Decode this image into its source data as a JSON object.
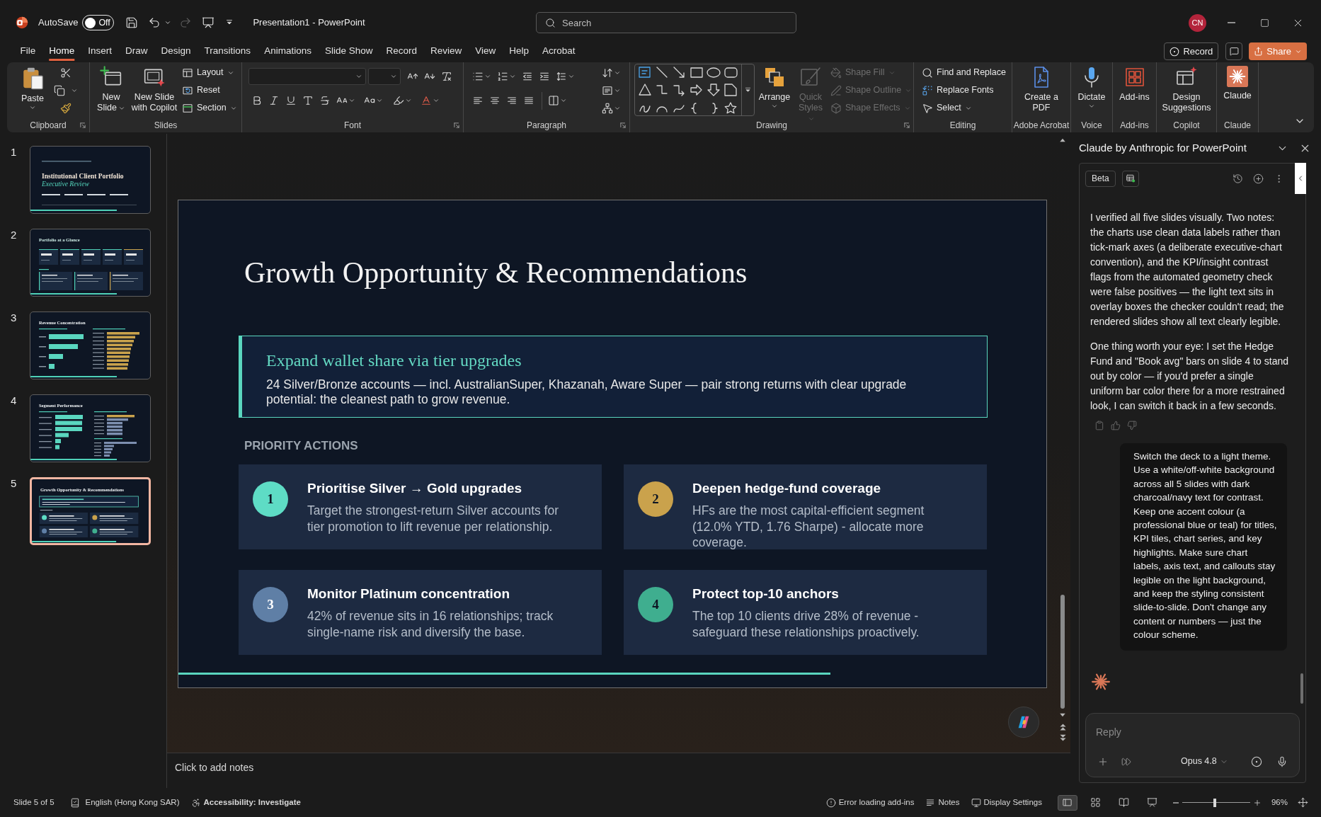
{
  "title_bar": {
    "autosave": {
      "label": "AutoSave",
      "on": false,
      "state": "Off"
    },
    "redo": {
      "disabled": true
    },
    "document_title": "Presentation1 - PowerPoint",
    "search": {
      "placeholder": "Search"
    },
    "account": {
      "initials": "CN"
    }
  },
  "menu_tabs": [
    {
      "label": "File",
      "selected": false
    },
    {
      "label": "Home",
      "selected": true
    },
    {
      "label": "Insert",
      "selected": false
    },
    {
      "label": "Draw",
      "selected": false
    },
    {
      "label": "Design",
      "selected": false
    },
    {
      "label": "Transitions",
      "selected": false
    },
    {
      "label": "Animations",
      "selected": false
    },
    {
      "label": "Slide Show",
      "selected": false
    },
    {
      "label": "Record",
      "selected": false
    },
    {
      "label": "Review",
      "selected": false
    },
    {
      "label": "View",
      "selected": false
    },
    {
      "label": "Help",
      "selected": false
    },
    {
      "label": "Acrobat",
      "selected": false
    }
  ],
  "header_buttons": {
    "record": "Record",
    "share": "Share"
  },
  "ribbon": {
    "clipboard": {
      "label": "Clipboard",
      "paste": "Paste"
    },
    "slides": {
      "label": "Slides",
      "new_slide": "New Slide",
      "new_slide_with_copilot": "New Slide with Copilot",
      "layout": "Layout",
      "reset": "Reset",
      "section": "Section"
    },
    "font": {
      "label": "Font"
    },
    "paragraph": {
      "label": "Paragraph"
    },
    "drawing": {
      "label": "Drawing",
      "arrange": "Arrange",
      "quick_styles": {
        "label": "Quick Styles",
        "disabled": true
      },
      "shape_fill": {
        "label": "Shape Fill",
        "disabled": true
      },
      "shape_outline": {
        "label": "Shape Outline",
        "disabled": true
      },
      "shape_effects": {
        "label": "Shape Effects",
        "disabled": true
      }
    },
    "editing": {
      "label": "Editing",
      "find_and_replace": "Find and Replace",
      "replace_fonts": "Replace Fonts",
      "select": "Select"
    },
    "adobe_acrobat": {
      "label": "Adobe Acrobat",
      "create_pdf": "Create a PDF"
    },
    "voice": {
      "label": "Voice",
      "dictate": "Dictate"
    },
    "add_ins": {
      "label": "Add-ins",
      "add_ins": "Add-ins"
    },
    "copilot": {
      "label": "Copilot",
      "design_suggestions": "Design Suggestions"
    },
    "claude": {
      "label": "Claude",
      "claude": "Claude"
    }
  },
  "slide_thumbnails": [
    {
      "number": "1",
      "kind": "title",
      "title": "Institutional Client Portfolio",
      "subtitle": "Executive Review",
      "selected": false
    },
    {
      "number": "2",
      "kind": "kpi",
      "title": "Portfolio at a Glance",
      "selected": false
    },
    {
      "number": "3",
      "kind": "bars",
      "title": "Revenue Concentration",
      "selected": false
    },
    {
      "number": "4",
      "kind": "segments",
      "title": "Segment Performance",
      "selected": false
    },
    {
      "number": "5",
      "kind": "cards",
      "title": "Growth Opportunity & Recommendations",
      "selected": true
    }
  ],
  "slide": {
    "title": "Growth Opportunity & Recommendations",
    "callout": {
      "heading": "Expand wallet share via tier upgrades",
      "body": "24 Silver/Bronze accounts — incl. AustralianSuper, Khazanah, Aware Super — pair strong returns with clear upgrade potential: the cleanest path to grow revenue."
    },
    "section_label": "PRIORITY ACTIONS",
    "actions": [
      {
        "number": "1",
        "title": "Prioritise Silver → Gold upgrades",
        "description": "Target the strongest-return Silver accounts for tier promotion to lift revenue per relationship.",
        "color": "#5edcc5"
      },
      {
        "number": "2",
        "title": "Deepen hedge-fund coverage",
        "description": "HFs are the most capital-efficient segment (12.0% YTD, 1.76 Sharpe) - allocate more coverage.",
        "color": "#caa24c"
      },
      {
        "number": "3",
        "title": "Monitor Platinum concentration",
        "description": "42% of revenue sits in 16 relationships; track single-name risk and diversify the base.",
        "color": "#5f7fa6"
      },
      {
        "number": "4",
        "title": "Protect top-10 anchors",
        "description": "The top 10 clients drive 28% of revenue - safeguard these relationships proactively.",
        "color": "#3fae8f"
      }
    ]
  },
  "notes": {
    "placeholder": "Click to add notes"
  },
  "claude_panel": {
    "title": "Claude by Anthropic for PowerPoint",
    "badge": "Beta",
    "messages": [
      {
        "kind": "assistant",
        "paragraphs": [
          "I verified all five slides visually. Two notes: the charts use clean data labels rather than tick-mark axes (a deliberate executive-chart convention), and the KPI/insight contrast flags from the automated geometry check were false positives — the light text sits in overlay boxes the checker couldn't read; the rendered slides show all text clearly legible.",
          "One thing worth your eye: I set the Hedge Fund and \"Book avg\" bars on slide 4 to stand out by color — if you'd prefer a single uniform bar color there for a more restrained look, I can switch it back in a few seconds."
        ]
      },
      {
        "kind": "user",
        "text": "Switch the deck to a light theme. Use a white/off-white background across all 5 slides with dark charcoal/navy text for contrast. Keep one accent colour (a professional blue or teal) for titles, KPI tiles, chart series, and key highlights. Make sure chart labels, axis text, and callouts stay legible on the light background, and keep the styling consistent slide-to-slide. Don't change any content or numbers — just the colour scheme."
      }
    ],
    "composer": {
      "placeholder": "Reply",
      "model": "Opus 4.8"
    }
  },
  "status_bar": {
    "slide_position": "Slide 5 of 5",
    "language": "English (Hong Kong SAR)",
    "accessibility": "Accessibility: Investigate",
    "add_ins_error": "Error loading add-ins",
    "notes": "Notes",
    "display_settings": "Display Settings",
    "views": [
      {
        "selected": true
      },
      {
        "selected": false
      },
      {
        "selected": false
      },
      {
        "selected": false
      }
    ],
    "zoom": {
      "level": 0.48,
      "reading": "96%"
    }
  }
}
